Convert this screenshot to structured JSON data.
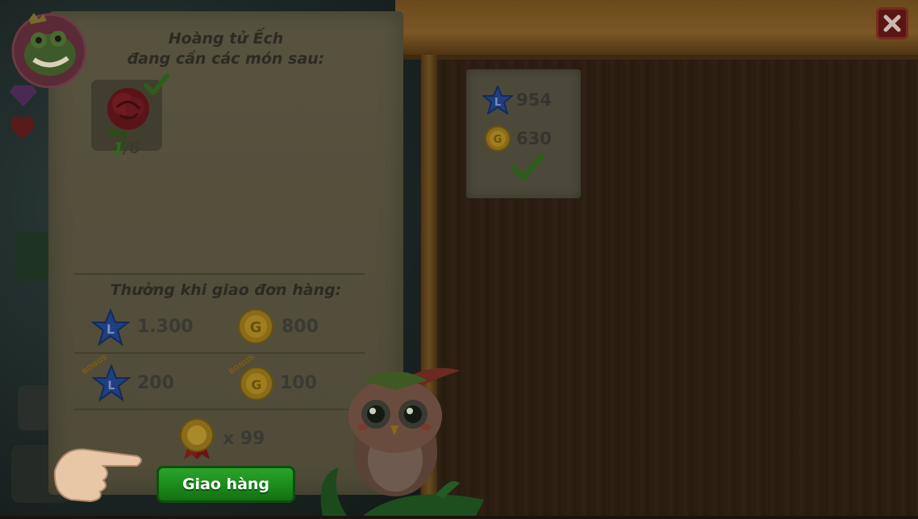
{
  "npc": {
    "title_line1": "Hoàng tử Ếch",
    "title_line2": "đang cần các món sau:"
  },
  "order": {
    "items": [
      {
        "icon": "rose-icon",
        "have": "1",
        "need": "/6"
      }
    ]
  },
  "requirements": {
    "xp_value": "954",
    "coin_value": "630"
  },
  "rewards": {
    "title": "Thưởng khi giao đơn hàng:",
    "xp": "1.300",
    "coins": "800",
    "bonus_xp": "200",
    "bonus_coins": "100",
    "bonus_label": "BONUS",
    "medal_count": "x 99"
  },
  "buttons": {
    "deliver": "Giao hàng"
  },
  "colors": {
    "parchment": "#57533f",
    "button_green": "#1b8a1b",
    "star_blue": "#1f4fa0",
    "coin_gold": "#b08a1c",
    "close_red": "#5a1612"
  }
}
